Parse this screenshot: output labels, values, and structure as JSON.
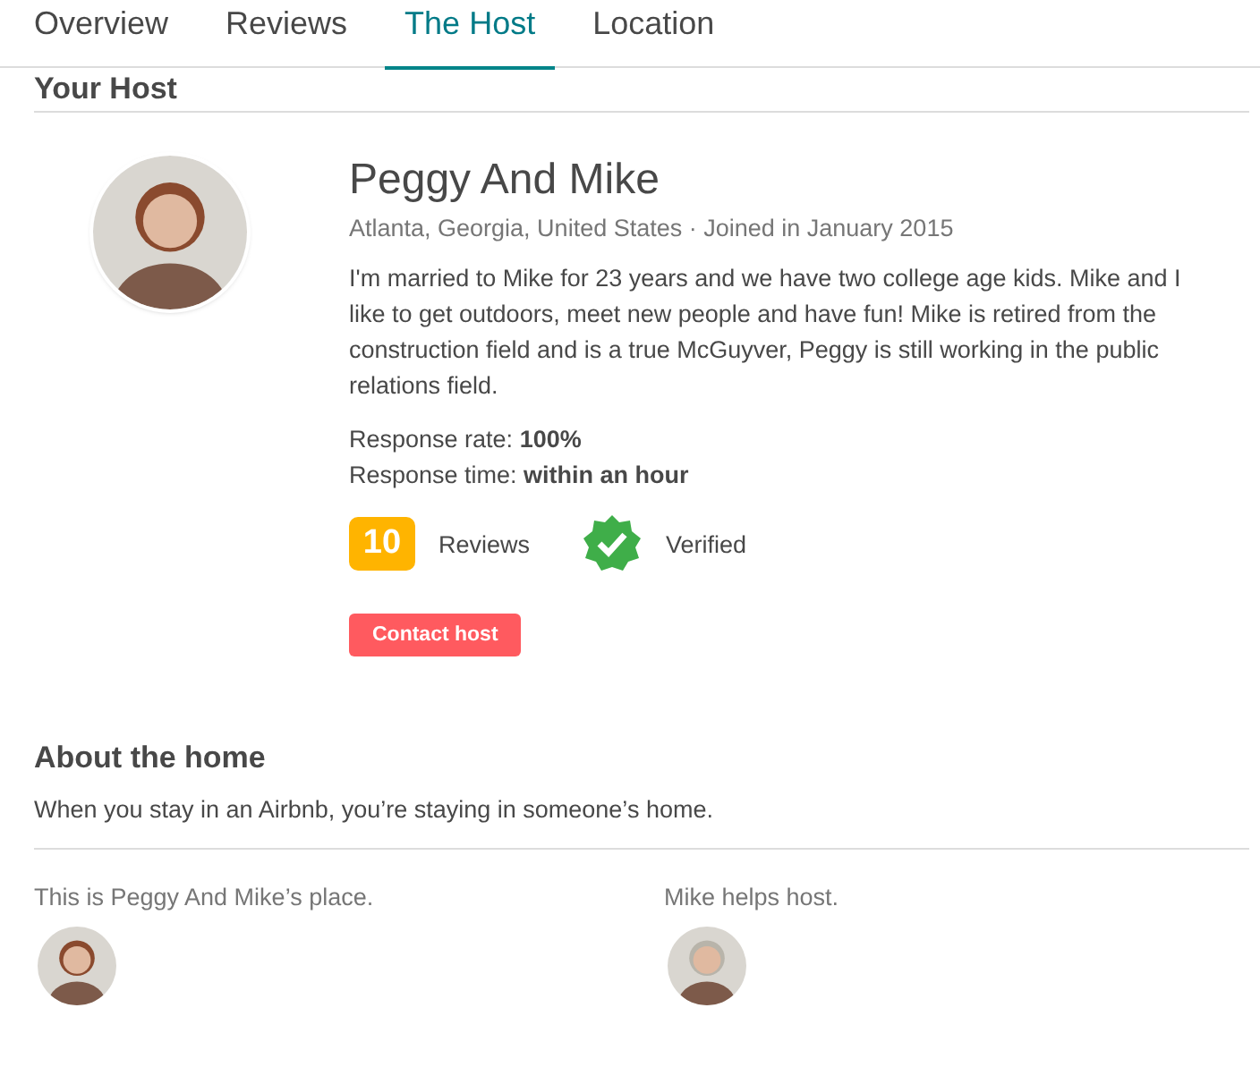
{
  "tabs": [
    {
      "label": "Overview",
      "selected": false
    },
    {
      "label": "Reviews",
      "selected": false
    },
    {
      "label": "The Host",
      "selected": true
    },
    {
      "label": "Location",
      "selected": false
    }
  ],
  "host": {
    "heading": "Your Host",
    "name": "Peggy And Mike",
    "meta": "Atlanta, Georgia, United States · Joined in January 2015",
    "bio": "I'm married to Mike for 23 years and we have two college age kids. Mike and I like to get outdoors, meet new people and have fun! Mike is retired from the construction field and is a true McGuyver, Peggy is still working in the public relations field.",
    "response_rate": "Response rate: **100%**",
    "response_time": "Response time: **within an hour**",
    "reviews_count": "10",
    "reviews_label": "Reviews",
    "verified_label": "Verified",
    "contact_button": "Contact host"
  },
  "about_home": {
    "title": "About the home",
    "text": "When you stay in an Airbnb, you’re staying in someone’s home.",
    "hosts": [
      {
        "caption": "This is Peggy And Mike’s place."
      },
      {
        "caption": "Mike helps host."
      }
    ]
  }
}
